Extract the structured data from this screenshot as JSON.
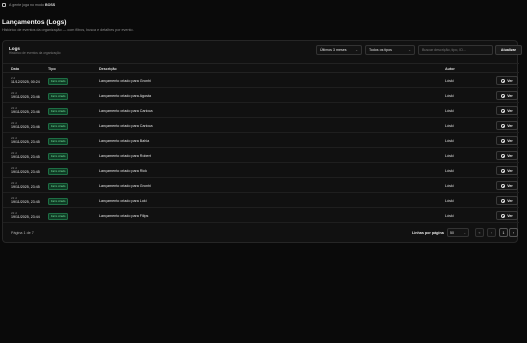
{
  "topbar": {
    "prefix": "A gente joga no modo ",
    "mode": "BOSS"
  },
  "page": {
    "title": "Lançamentos (Logs)",
    "subtitle": "Histórico de eventos da organização — com filtros, busca e detalhes por evento."
  },
  "card": {
    "title": "Logs",
    "subtitle": "Histórico de eventos da organização"
  },
  "filters": {
    "period": "Últimos 3 meses",
    "type": "Todos os tipos",
    "search_placeholder": "Buscar descrição, tipo, ID...",
    "update_label": "Atualizar"
  },
  "table": {
    "headers": {
      "date": "Data",
      "type": "Tipo",
      "desc": "Descrição",
      "author": "Autor"
    },
    "action_label": "Ver",
    "rows": [
      {
        "small": "2 d",
        "date": "11/12/2025, 00:24",
        "type": "Farm criado",
        "desc": "Lançamento criado para Gronhi",
        "author": "Lóski"
      },
      {
        "small": "22 d",
        "date": "19/11/2025, 23:46",
        "type": "Farm criado",
        "desc": "Lançamento criado para Agosta",
        "author": "Lóski"
      },
      {
        "small": "22 d",
        "date": "19/11/2025, 23:46",
        "type": "Farm criado",
        "desc": "Lançamento criado para Carioca",
        "author": "Lóski"
      },
      {
        "small": "22 d",
        "date": "19/11/2025, 23:46",
        "type": "Farm criado",
        "desc": "Lançamento criado para Carioca",
        "author": "Lóski"
      },
      {
        "small": "22 d",
        "date": "19/11/2025, 23:45",
        "type": "Farm criado",
        "desc": "Lançamento criado para Bahia",
        "author": "Lóski"
      },
      {
        "small": "22 d",
        "date": "19/11/2025, 23:45",
        "type": "Farm criado",
        "desc": "Lançamento criado para Robert",
        "author": "Lóski"
      },
      {
        "small": "22 d",
        "date": "19/11/2025, 23:45",
        "type": "Farm criado",
        "desc": "Lançamento criado para Rick",
        "author": "Lóski"
      },
      {
        "small": "22 d",
        "date": "19/11/2025, 23:45",
        "type": "Farm criado",
        "desc": "Lançamento criado para Gronhi",
        "author": "Lóski"
      },
      {
        "small": "22 d",
        "date": "19/11/2025, 23:45",
        "type": "Farm criado",
        "desc": "Lançamento criado para Loki",
        "author": "Lóski"
      },
      {
        "small": "22 d",
        "date": "19/11/2025, 23:44",
        "type": "Farm criado",
        "desc": "Lançamento criado para Filips",
        "author": "Lóski"
      }
    ]
  },
  "pagination": {
    "page_text": "Página 1 de 7",
    "rows_label": "Linhas por página",
    "rows_value": "50",
    "first": "«",
    "prev": "‹",
    "current": "1",
    "next": "›"
  }
}
